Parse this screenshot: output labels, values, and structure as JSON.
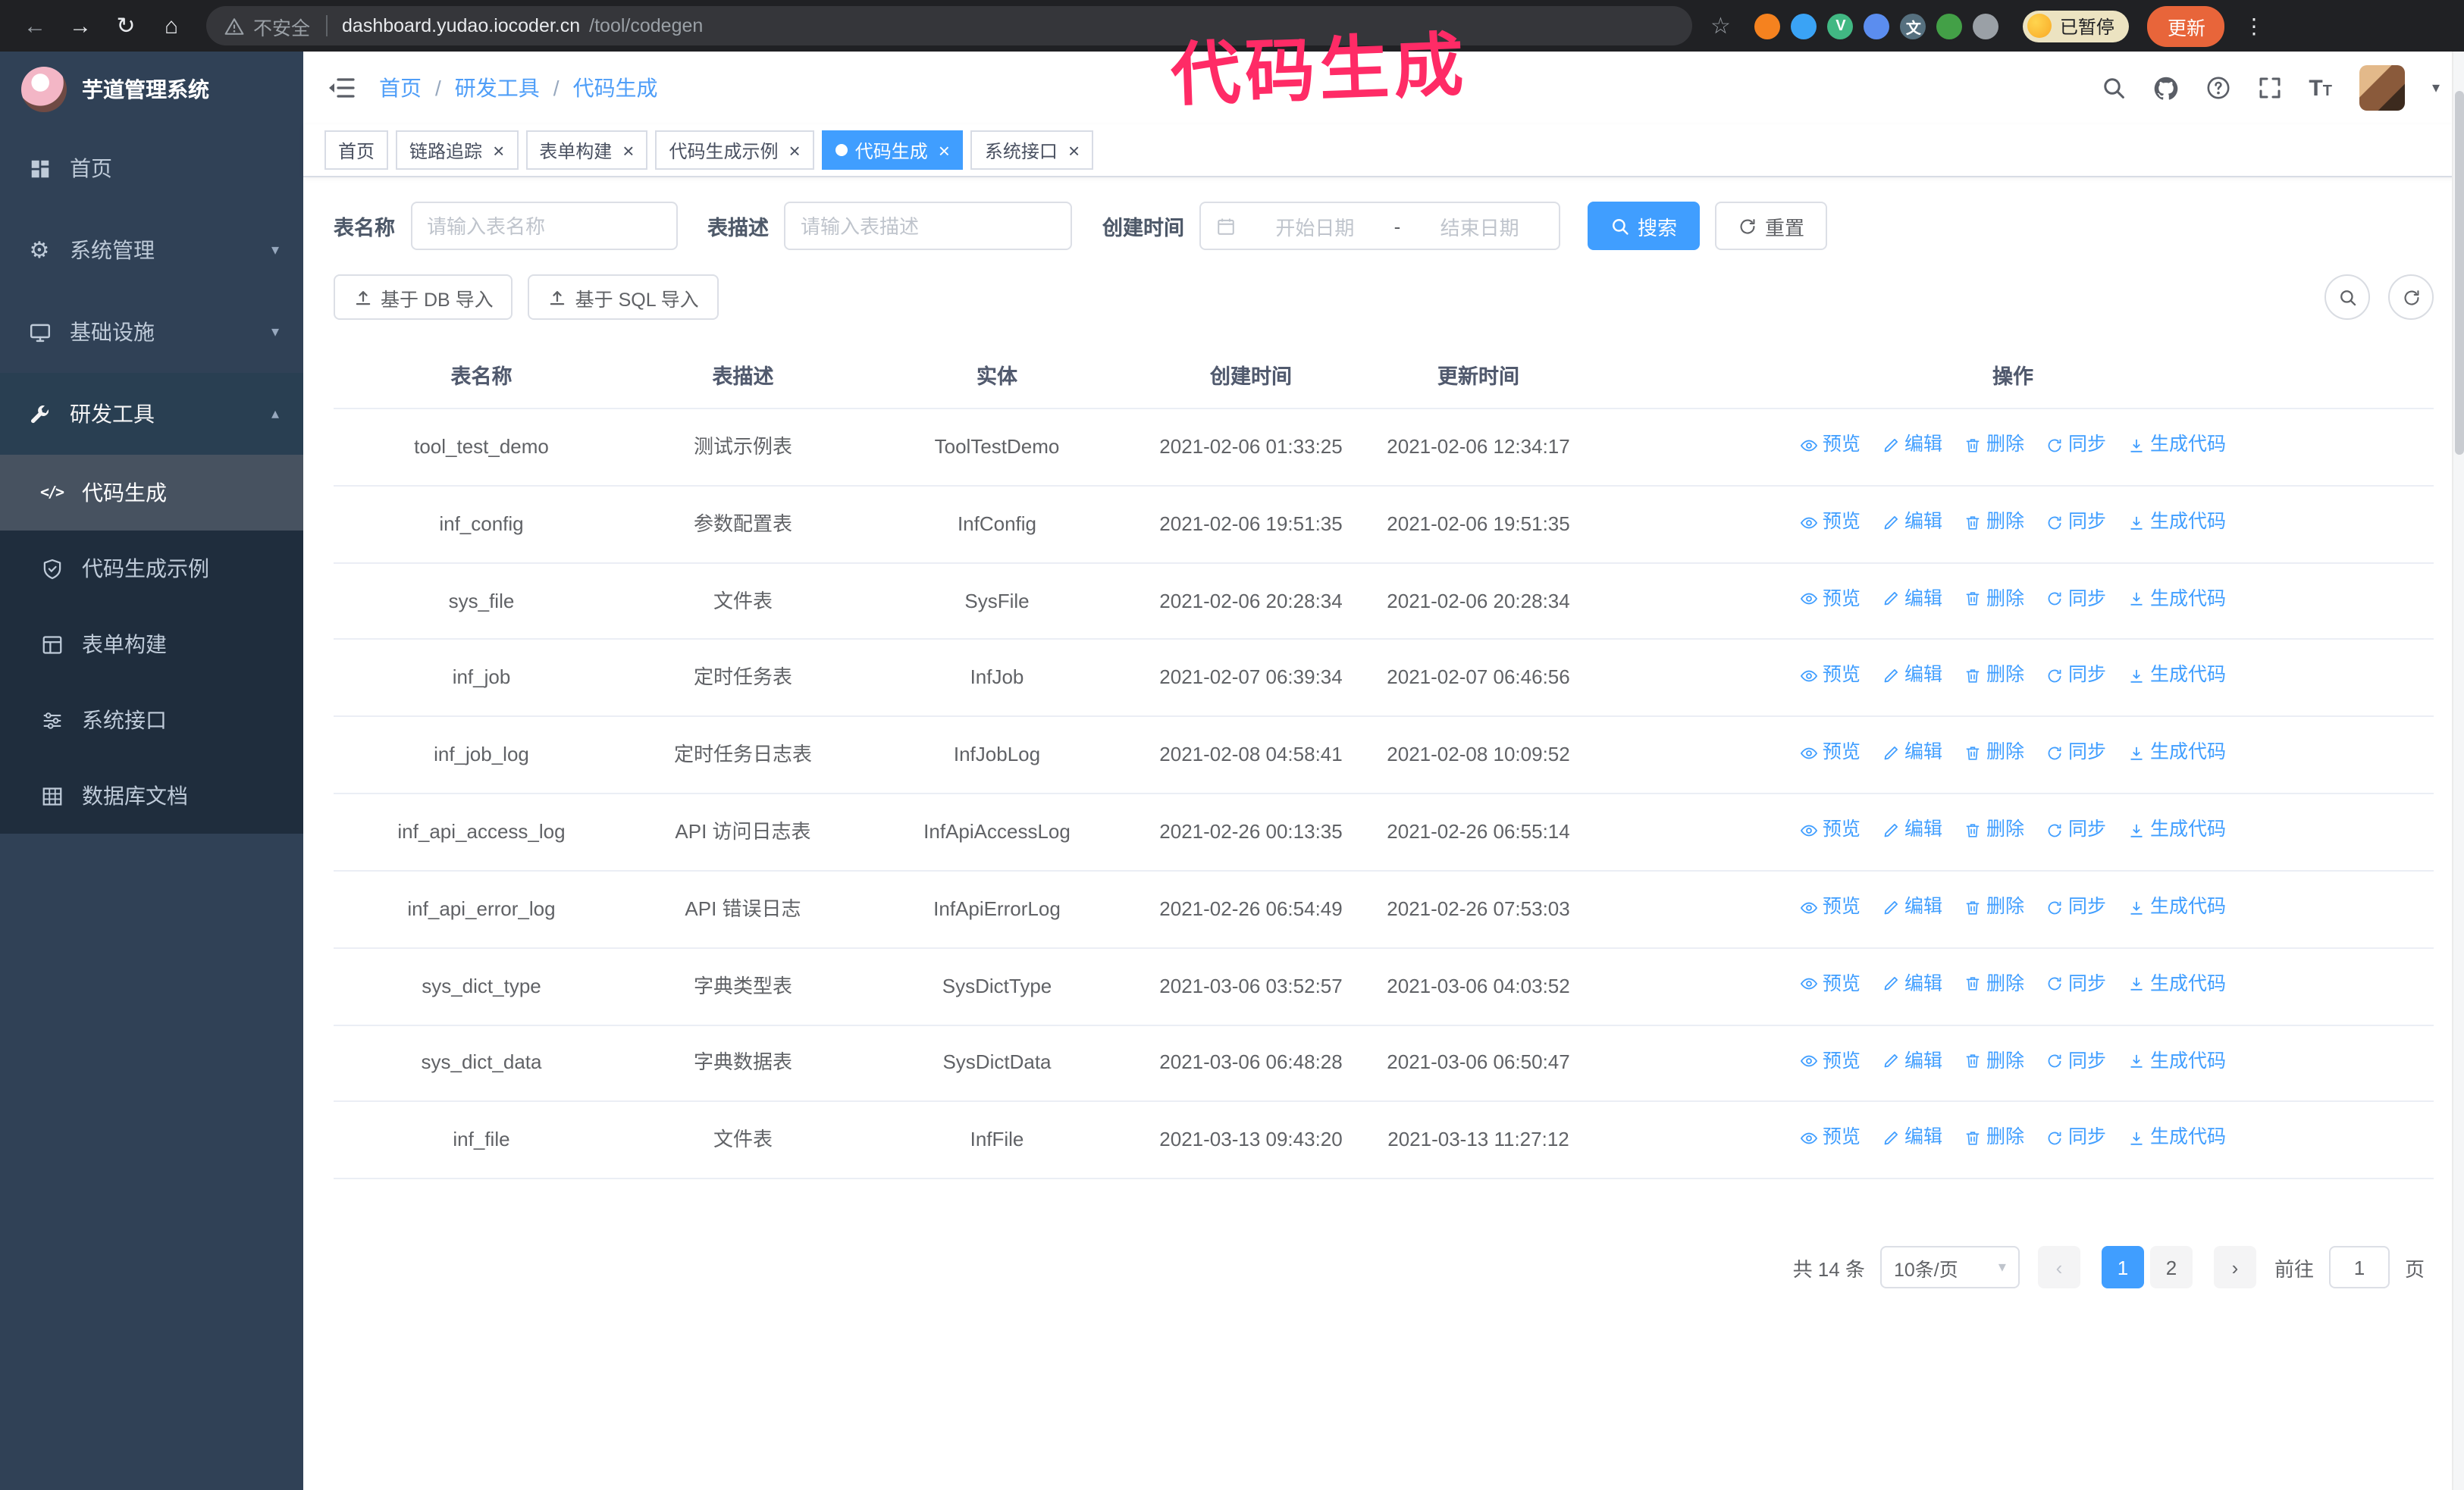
{
  "browser": {
    "security_label": "不安全",
    "url_host": "dashboard.yudao.iocoder.cn",
    "url_path": "/tool/codegen",
    "paused_badge": "已暂停",
    "update_button": "更新",
    "extensions": [
      {
        "name": "orange",
        "color": "#f5821f",
        "glyph": ""
      },
      {
        "name": "blue-drop",
        "color": "#3aa3f5",
        "glyph": ""
      },
      {
        "name": "vue-devtools",
        "color": "#41b883",
        "glyph": "V"
      },
      {
        "name": "contacts",
        "color": "#5b8def",
        "glyph": ""
      },
      {
        "name": "translate",
        "color": "#56707f",
        "glyph": "文"
      },
      {
        "name": "green-plant",
        "color": "#43a047",
        "glyph": ""
      },
      {
        "name": "puzzle",
        "color": "#9aa0a6",
        "glyph": ""
      }
    ]
  },
  "annotation": {
    "text": "代码生成",
    "color": "#ff2b66"
  },
  "sidebar": {
    "logo_title": "芋道管理系统",
    "items": [
      {
        "label": "首页"
      },
      {
        "label": "系统管理"
      },
      {
        "label": "基础设施"
      },
      {
        "label": "研发工具"
      }
    ],
    "sub_items": [
      {
        "label": "代码生成"
      },
      {
        "label": "代码生成示例"
      },
      {
        "label": "表单构建"
      },
      {
        "label": "系统接口"
      },
      {
        "label": "数据库文档"
      }
    ]
  },
  "header": {
    "breadcrumb": [
      "首页",
      "研发工具",
      "代码生成"
    ]
  },
  "tabs": [
    {
      "label": "首页",
      "closable": false,
      "active": false
    },
    {
      "label": "链路追踪",
      "closable": true,
      "active": false
    },
    {
      "label": "表单构建",
      "closable": true,
      "active": false
    },
    {
      "label": "代码生成示例",
      "closable": true,
      "active": false
    },
    {
      "label": "代码生成",
      "closable": true,
      "active": true
    },
    {
      "label": "系统接口",
      "closable": true,
      "active": false
    }
  ],
  "filters": {
    "table_name_label": "表名称",
    "table_name_placeholder": "请输入表名称",
    "table_desc_label": "表描述",
    "table_desc_placeholder": "请输入表描述",
    "create_time_label": "创建时间",
    "date_start_placeholder": "开始日期",
    "date_separator": "-",
    "date_end_placeholder": "结束日期",
    "search_button": "搜索",
    "reset_button": "重置"
  },
  "toolbar": {
    "import_db": "基于 DB 导入",
    "import_sql": "基于 SQL 导入"
  },
  "table": {
    "columns": [
      "表名称",
      "表描述",
      "实体",
      "创建时间",
      "更新时间",
      "操作"
    ],
    "actions": [
      {
        "key": "preview",
        "icon": "eye",
        "label": "预览"
      },
      {
        "key": "edit",
        "icon": "edit",
        "label": "编辑"
      },
      {
        "key": "delete",
        "icon": "delete",
        "label": "删除"
      },
      {
        "key": "sync",
        "icon": "sync",
        "label": "同步"
      },
      {
        "key": "generate-code",
        "icon": "download",
        "label": "生成代码"
      }
    ],
    "rows": [
      {
        "name": "tool_test_demo",
        "desc": "测试示例表",
        "entity": "ToolTestDemo",
        "created": "2021-02-06 01:33:25",
        "updated": "2021-02-06 12:34:17"
      },
      {
        "name": "inf_config",
        "desc": "参数配置表",
        "entity": "InfConfig",
        "created": "2021-02-06 19:51:35",
        "updated": "2021-02-06 19:51:35"
      },
      {
        "name": "sys_file",
        "desc": "文件表",
        "entity": "SysFile",
        "created": "2021-02-06 20:28:34",
        "updated": "2021-02-06 20:28:34"
      },
      {
        "name": "inf_job",
        "desc": "定时任务表",
        "entity": "InfJob",
        "created": "2021-02-07 06:39:34",
        "updated": "2021-02-07 06:46:56"
      },
      {
        "name": "inf_job_log",
        "desc": "定时任务日志表",
        "entity": "InfJobLog",
        "created": "2021-02-08 04:58:41",
        "updated": "2021-02-08 10:09:52"
      },
      {
        "name": "inf_api_access_log",
        "desc": "API 访问日志表",
        "entity": "InfApiAccessLog",
        "created": "2021-02-26 00:13:35",
        "updated": "2021-02-26 06:55:14"
      },
      {
        "name": "inf_api_error_log",
        "desc": "API 错误日志",
        "entity": "InfApiErrorLog",
        "created": "2021-02-26 06:54:49",
        "updated": "2021-02-26 07:53:03"
      },
      {
        "name": "sys_dict_type",
        "desc": "字典类型表",
        "entity": "SysDictType",
        "created": "2021-03-06 03:52:57",
        "updated": "2021-03-06 04:03:52"
      },
      {
        "name": "sys_dict_data",
        "desc": "字典数据表",
        "entity": "SysDictData",
        "created": "2021-03-06 06:48:28",
        "updated": "2021-03-06 06:50:47"
      },
      {
        "name": "inf_file",
        "desc": "文件表",
        "entity": "InfFile",
        "created": "2021-03-13 09:43:20",
        "updated": "2021-03-13 11:27:12"
      }
    ]
  },
  "pagination": {
    "total": "共 14 条",
    "page_size": "10条/页",
    "pages": [
      "1",
      "2"
    ],
    "active_page": "1",
    "goto_label": "前往",
    "goto_value": "1",
    "goto_suffix": "页"
  }
}
